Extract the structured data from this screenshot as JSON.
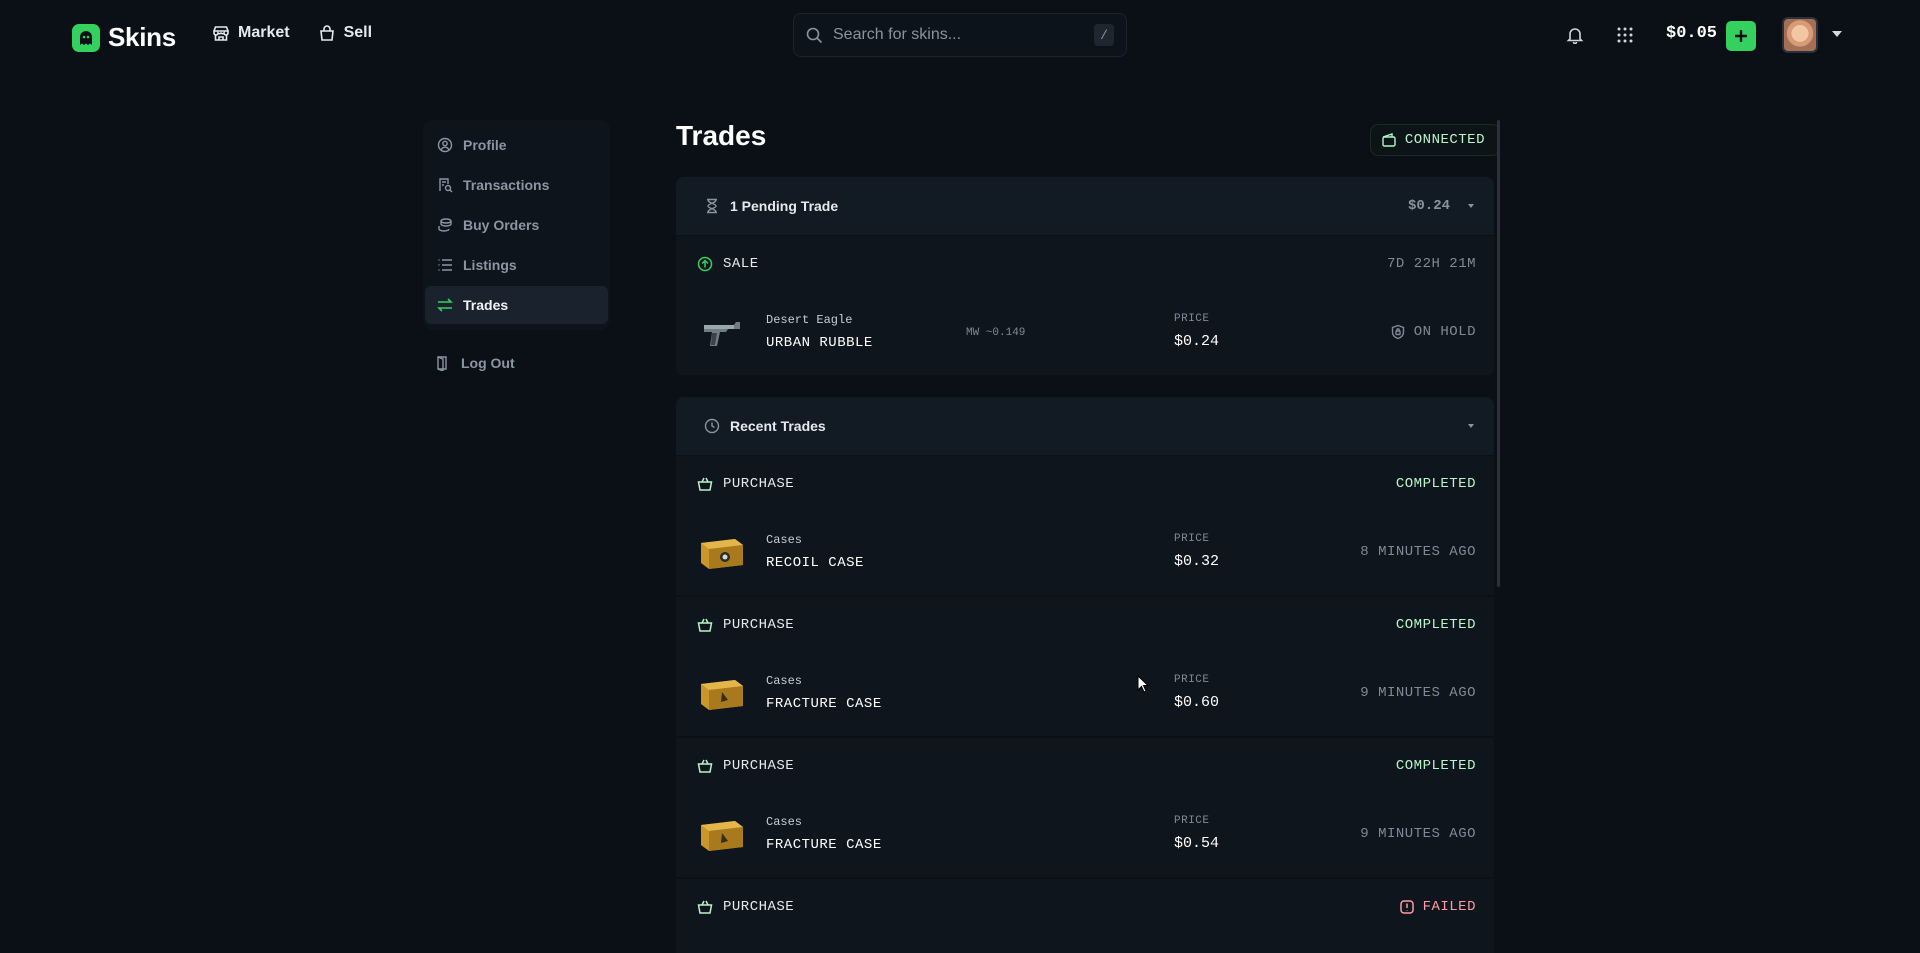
{
  "brand": {
    "name": "Skins",
    "accent": "#35d15f"
  },
  "nav": [
    {
      "label": "Market",
      "icon": "storefront-icon"
    },
    {
      "label": "Sell",
      "icon": "bag-icon"
    }
  ],
  "search": {
    "placeholder": "Search for skins...",
    "shortcut": "/"
  },
  "header": {
    "balance": "$0.05"
  },
  "sidebar": {
    "items": [
      {
        "label": "Profile",
        "icon": "user-circle-icon",
        "active": false
      },
      {
        "label": "Transactions",
        "icon": "receipt-search-icon",
        "active": false
      },
      {
        "label": "Buy Orders",
        "icon": "coins-icon",
        "active": false
      },
      {
        "label": "Listings",
        "icon": "list-icon",
        "active": false
      },
      {
        "label": "Trades",
        "icon": "swap-arrows-icon",
        "active": true
      }
    ],
    "logout": "Log Out"
  },
  "page": {
    "title": "Trades",
    "connection_status": "CONNECTED"
  },
  "pending": {
    "title": "1 Pending Trade",
    "total": "$0.24",
    "trade": {
      "type": "SALE",
      "timer": "7D 22H 21M",
      "item": {
        "category": "Desert Eagle",
        "name": "URBAN RUBBLE",
        "float": "MW ~0.149",
        "price_label": "PRICE",
        "price": "$0.24",
        "status": "ON HOLD"
      }
    }
  },
  "recent": {
    "title": "Recent Trades",
    "trades": [
      {
        "type": "PURCHASE",
        "status": "COMPLETED",
        "category": "Cases",
        "name": "RECOIL CASE",
        "price_label": "PRICE",
        "price": "$0.32",
        "time": "8 MINUTES AGO"
      },
      {
        "type": "PURCHASE",
        "status": "COMPLETED",
        "category": "Cases",
        "name": "FRACTURE CASE",
        "price_label": "PRICE",
        "price": "$0.60",
        "time": "9 MINUTES AGO"
      },
      {
        "type": "PURCHASE",
        "status": "COMPLETED",
        "category": "Cases",
        "name": "FRACTURE CASE",
        "price_label": "PRICE",
        "price": "$0.54",
        "time": "9 MINUTES AGO"
      },
      {
        "type": "PURCHASE",
        "status": "FAILED"
      }
    ]
  }
}
